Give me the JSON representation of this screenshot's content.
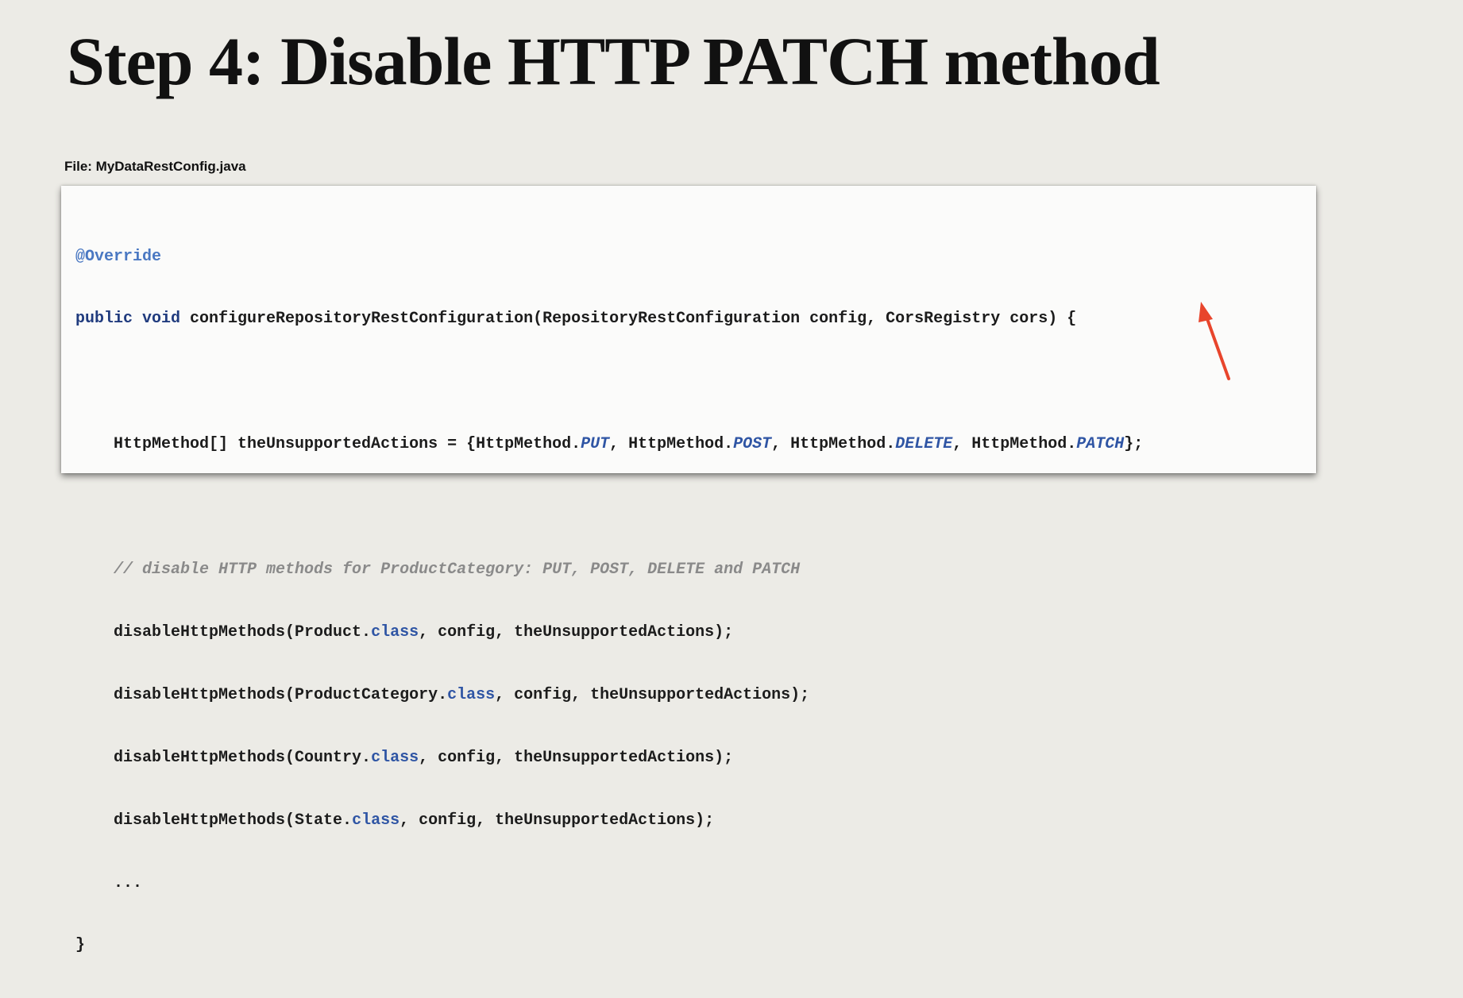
{
  "slide": {
    "title": "Step 4: Disable HTTP PATCH method",
    "file_label": "File: MyDataRestConfig.java"
  },
  "code": {
    "annotation": "@Override",
    "method_kw": "public void",
    "method_sig": " configureRepositoryRestConfiguration(RepositoryRestConfiguration config, CorsRegistry cors) {",
    "actions_decl": "    HttpMethod[] theUnsupportedActions = {HttpMethod.",
    "put": "PUT",
    "sep_post": ", HttpMethod.",
    "post": "POST",
    "sep_delete": ", HttpMethod.",
    "delete": "DELETE",
    "sep_patch": ", HttpMethod.",
    "patch": "PATCH",
    "actions_end": "};",
    "comment": "    // disable HTTP methods for ProductCategory: PUT, POST, DELETE and PATCH",
    "calls": [
      {
        "prefix": "    disableHttpMethods(Product.",
        "keyword": "class",
        "suffix": ", config, theUnsupportedActions);"
      },
      {
        "prefix": "    disableHttpMethods(ProductCategory.",
        "keyword": "class",
        "suffix": ", config, theUnsupportedActions);"
      },
      {
        "prefix": "    disableHttpMethods(Country.",
        "keyword": "class",
        "suffix": ", config, theUnsupportedActions);"
      },
      {
        "prefix": "    disableHttpMethods(State.",
        "keyword": "class",
        "suffix": ", config, theUnsupportedActions);"
      }
    ],
    "ellipsis": "    ...",
    "closing_brace": "}"
  },
  "colors": {
    "annotation": "#4a78c2",
    "keyword": "#203b7e",
    "constant": "#2f55a4",
    "comment": "#8a8a8a",
    "arrow": "#e8452c"
  },
  "icons": {
    "pointer": "red-arrow-icon"
  }
}
